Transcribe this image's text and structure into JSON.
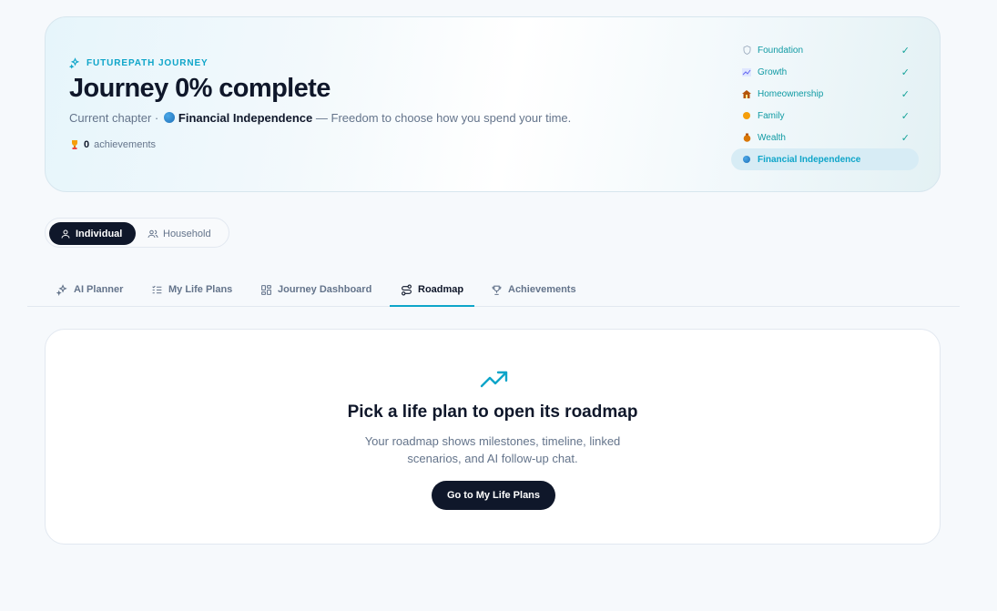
{
  "hero": {
    "kicker": "FUTUREPATH JOURNEY",
    "title": "Journey 0% complete",
    "chapter_prefix": "Current chapter ·",
    "chapter_name": "Financial Independence",
    "chapter_desc": "— Freedom to choose how you spend your time.",
    "achievements_count": "0",
    "achievements_label": "achievements"
  },
  "stages": [
    {
      "label": "Foundation",
      "icon": "shield-icon",
      "done": "✓"
    },
    {
      "label": "Growth",
      "icon": "chart-icon",
      "done": "✓"
    },
    {
      "label": "Homeownership",
      "icon": "house-icon",
      "done": "✓"
    },
    {
      "label": "Family",
      "icon": "family-icon",
      "done": "✓"
    },
    {
      "label": "Wealth",
      "icon": "money-bag-icon",
      "done": "✓"
    },
    {
      "label": "Financial Independence",
      "icon": "globe-icon",
      "active": true
    }
  ],
  "mode_toggle": {
    "individual": "Individual",
    "household": "Household"
  },
  "tabs": [
    {
      "label": "AI Planner",
      "icon": "sparkles-icon"
    },
    {
      "label": "My Life Plans",
      "icon": "list-icon"
    },
    {
      "label": "Journey Dashboard",
      "icon": "grid-icon"
    },
    {
      "label": "Roadmap",
      "icon": "route-icon",
      "active": true
    },
    {
      "label": "Achievements",
      "icon": "trophy-icon"
    }
  ],
  "empty_state": {
    "title": "Pick a life plan to open its roadmap",
    "description": "Your roadmap shows milestones, timeline, linked scenarios, and AI follow-up chat.",
    "button": "Go to My Life Plans"
  },
  "colors": {
    "accent": "#0ea5c9",
    "dark": "#0f172a",
    "muted": "#64748b",
    "success": "#16a39a"
  }
}
